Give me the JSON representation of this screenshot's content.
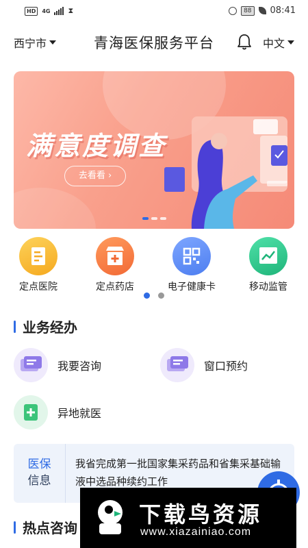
{
  "status_bar": {
    "left_badge": "HD",
    "network": "4G",
    "battery": "88",
    "time": "08:41"
  },
  "header": {
    "city": "西宁市",
    "title": "青海医保服务平台",
    "language": "中文"
  },
  "banner": {
    "title": "满意度调查",
    "button_label": "去看看",
    "slides": 3,
    "active_slide": 1
  },
  "quick_links": [
    {
      "label": "定点医院",
      "icon": "hospital-doc-icon",
      "color": "#f8b72c"
    },
    {
      "label": "定点药店",
      "icon": "pharmacy-store-icon",
      "color": "#f47a45"
    },
    {
      "label": "电子健康卡",
      "icon": "qr-code-icon",
      "color": "#5a8af2"
    },
    {
      "label": "移动监管",
      "icon": "trend-chart-icon",
      "color": "#2fc48a"
    }
  ],
  "quick_link_pages": 2,
  "business": {
    "title": "业务经办",
    "items": [
      {
        "label": "我要咨询",
        "icon": "consult-icon"
      },
      {
        "label": "窗口预约",
        "icon": "appointment-icon"
      },
      {
        "label": "异地就医",
        "icon": "medical-plus-icon"
      }
    ]
  },
  "news": {
    "tag_line1": "医保",
    "tag_line2": "信息",
    "text": "我省完成第一批国家集采药品和省集采基础输液中选品种续约工作"
  },
  "hot": {
    "title": "热点咨询"
  },
  "watermark": {
    "title": "下载鸟资源",
    "url": "www.xiazainiao.com"
  },
  "colors": {
    "accent": "#2f6be4",
    "banner": "#f9a08c"
  }
}
